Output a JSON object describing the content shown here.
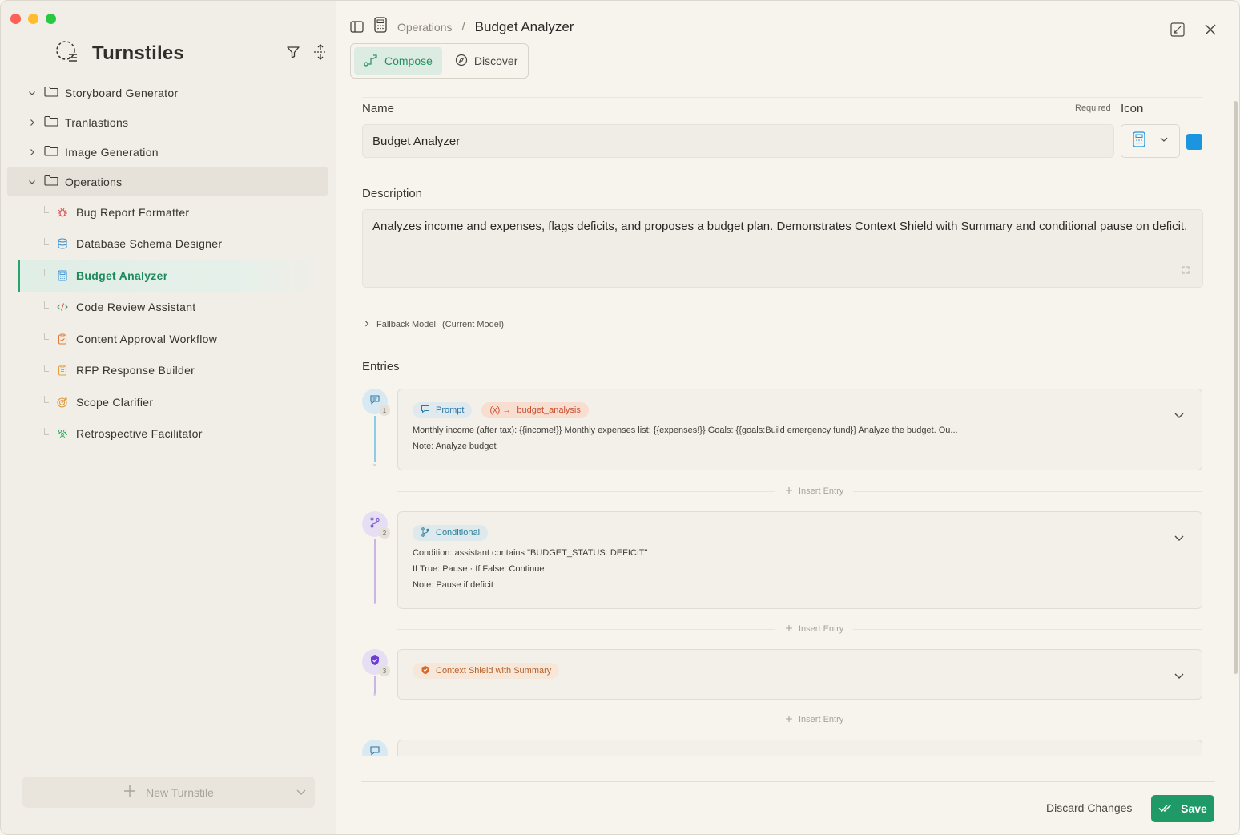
{
  "app": {
    "title": "Turnstiles"
  },
  "sidebar": {
    "folders": [
      {
        "label": "Storyboard Generator",
        "expanded": true
      },
      {
        "label": "Tranlastions",
        "expanded": false
      },
      {
        "label": "Image Generation",
        "expanded": false
      },
      {
        "label": "Operations",
        "expanded": true,
        "active": true
      }
    ],
    "items": [
      {
        "label": "Bug Report Formatter",
        "icon": "bug-icon",
        "color": "#d9534f"
      },
      {
        "label": "Database Schema Designer",
        "icon": "database-icon",
        "color": "#3b8fd0"
      },
      {
        "label": "Budget Analyzer",
        "icon": "calculator-icon",
        "color": "#3b8fd0",
        "selected": true
      },
      {
        "label": "Code Review Assistant",
        "icon": "code-icon",
        "color": "#3a9a6a"
      },
      {
        "label": "Content Approval Workflow",
        "icon": "clipboard-check-icon",
        "color": "#e07a3a"
      },
      {
        "label": "RFP Response Builder",
        "icon": "clipboard-list-icon",
        "color": "#e0a23a"
      },
      {
        "label": "Scope Clarifier",
        "icon": "target-icon",
        "color": "#e09a3a"
      },
      {
        "label": "Retrospective Facilitator",
        "icon": "people-icon",
        "color": "#3bb36a"
      }
    ],
    "new_button": "New Turnstile"
  },
  "header": {
    "breadcrumb_parent": "Operations",
    "breadcrumb_sep": "/",
    "title": "Budget Analyzer"
  },
  "tabs": [
    {
      "label": "Compose",
      "active": true
    },
    {
      "label": "Discover",
      "active": false
    }
  ],
  "form": {
    "name_label": "Name",
    "required_label": "Required",
    "icon_label": "Icon",
    "name_value": "Budget Analyzer",
    "icon_color": "#1b95e0",
    "description_label": "Description",
    "description_value": "Analyzes income and expenses, flags deficits, and proposes a budget plan. Demonstrates Context Shield with Summary and conditional pause on deficit.",
    "fallback_label": "Fallback Model",
    "fallback_value": "(Current Model)",
    "entries_label": "Entries"
  },
  "entries": [
    {
      "step": "1",
      "type": "Prompt",
      "var_chip": "budget_analysis",
      "var_prefix": "(x) →",
      "line1": "Monthly income (after tax): {{income!}} Monthly expenses list: {{expenses!}} Goals: {{goals:Build emergency fund}} Analyze the budget. Ou...",
      "line2": "Note: Analyze budget"
    },
    {
      "step": "2",
      "type": "Conditional",
      "line1": "Condition: assistant contains \"BUDGET_STATUS: DEFICIT\"",
      "line2": "If True: Pause · If False: Continue",
      "line3": "Note: Pause if deficit"
    },
    {
      "step": "3",
      "type": "Context Shield with Summary"
    }
  ],
  "insert_label": "Insert Entry",
  "footer": {
    "discard": "Discard Changes",
    "save": "Save"
  }
}
